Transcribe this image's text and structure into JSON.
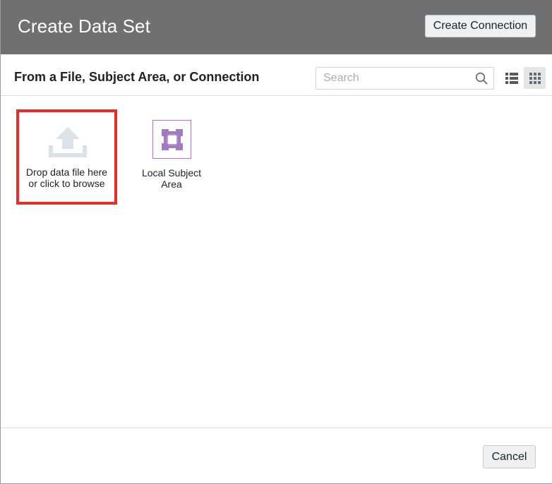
{
  "header": {
    "title": "Create Data Set",
    "create_connection_label": "Create Connection"
  },
  "subheader": {
    "title": "From a File, Subject Area, or Connection",
    "search_placeholder": "Search",
    "view_modes": [
      "list",
      "grid"
    ],
    "active_view": "grid"
  },
  "tiles": [
    {
      "label_line1": "Drop data file here",
      "label_line2": "or click to browse",
      "icon": "upload-icon",
      "highlighted": true
    },
    {
      "label_line1": "Local Subject",
      "label_line2": "Area",
      "icon": "subject-area-icon"
    }
  ],
  "footer": {
    "cancel_label": "Cancel"
  },
  "colors": {
    "header_bg": "#707070",
    "highlight_border": "#ee2a24",
    "subject_accent": "#a07cc0",
    "upload_icon": "#dbe3ea"
  }
}
